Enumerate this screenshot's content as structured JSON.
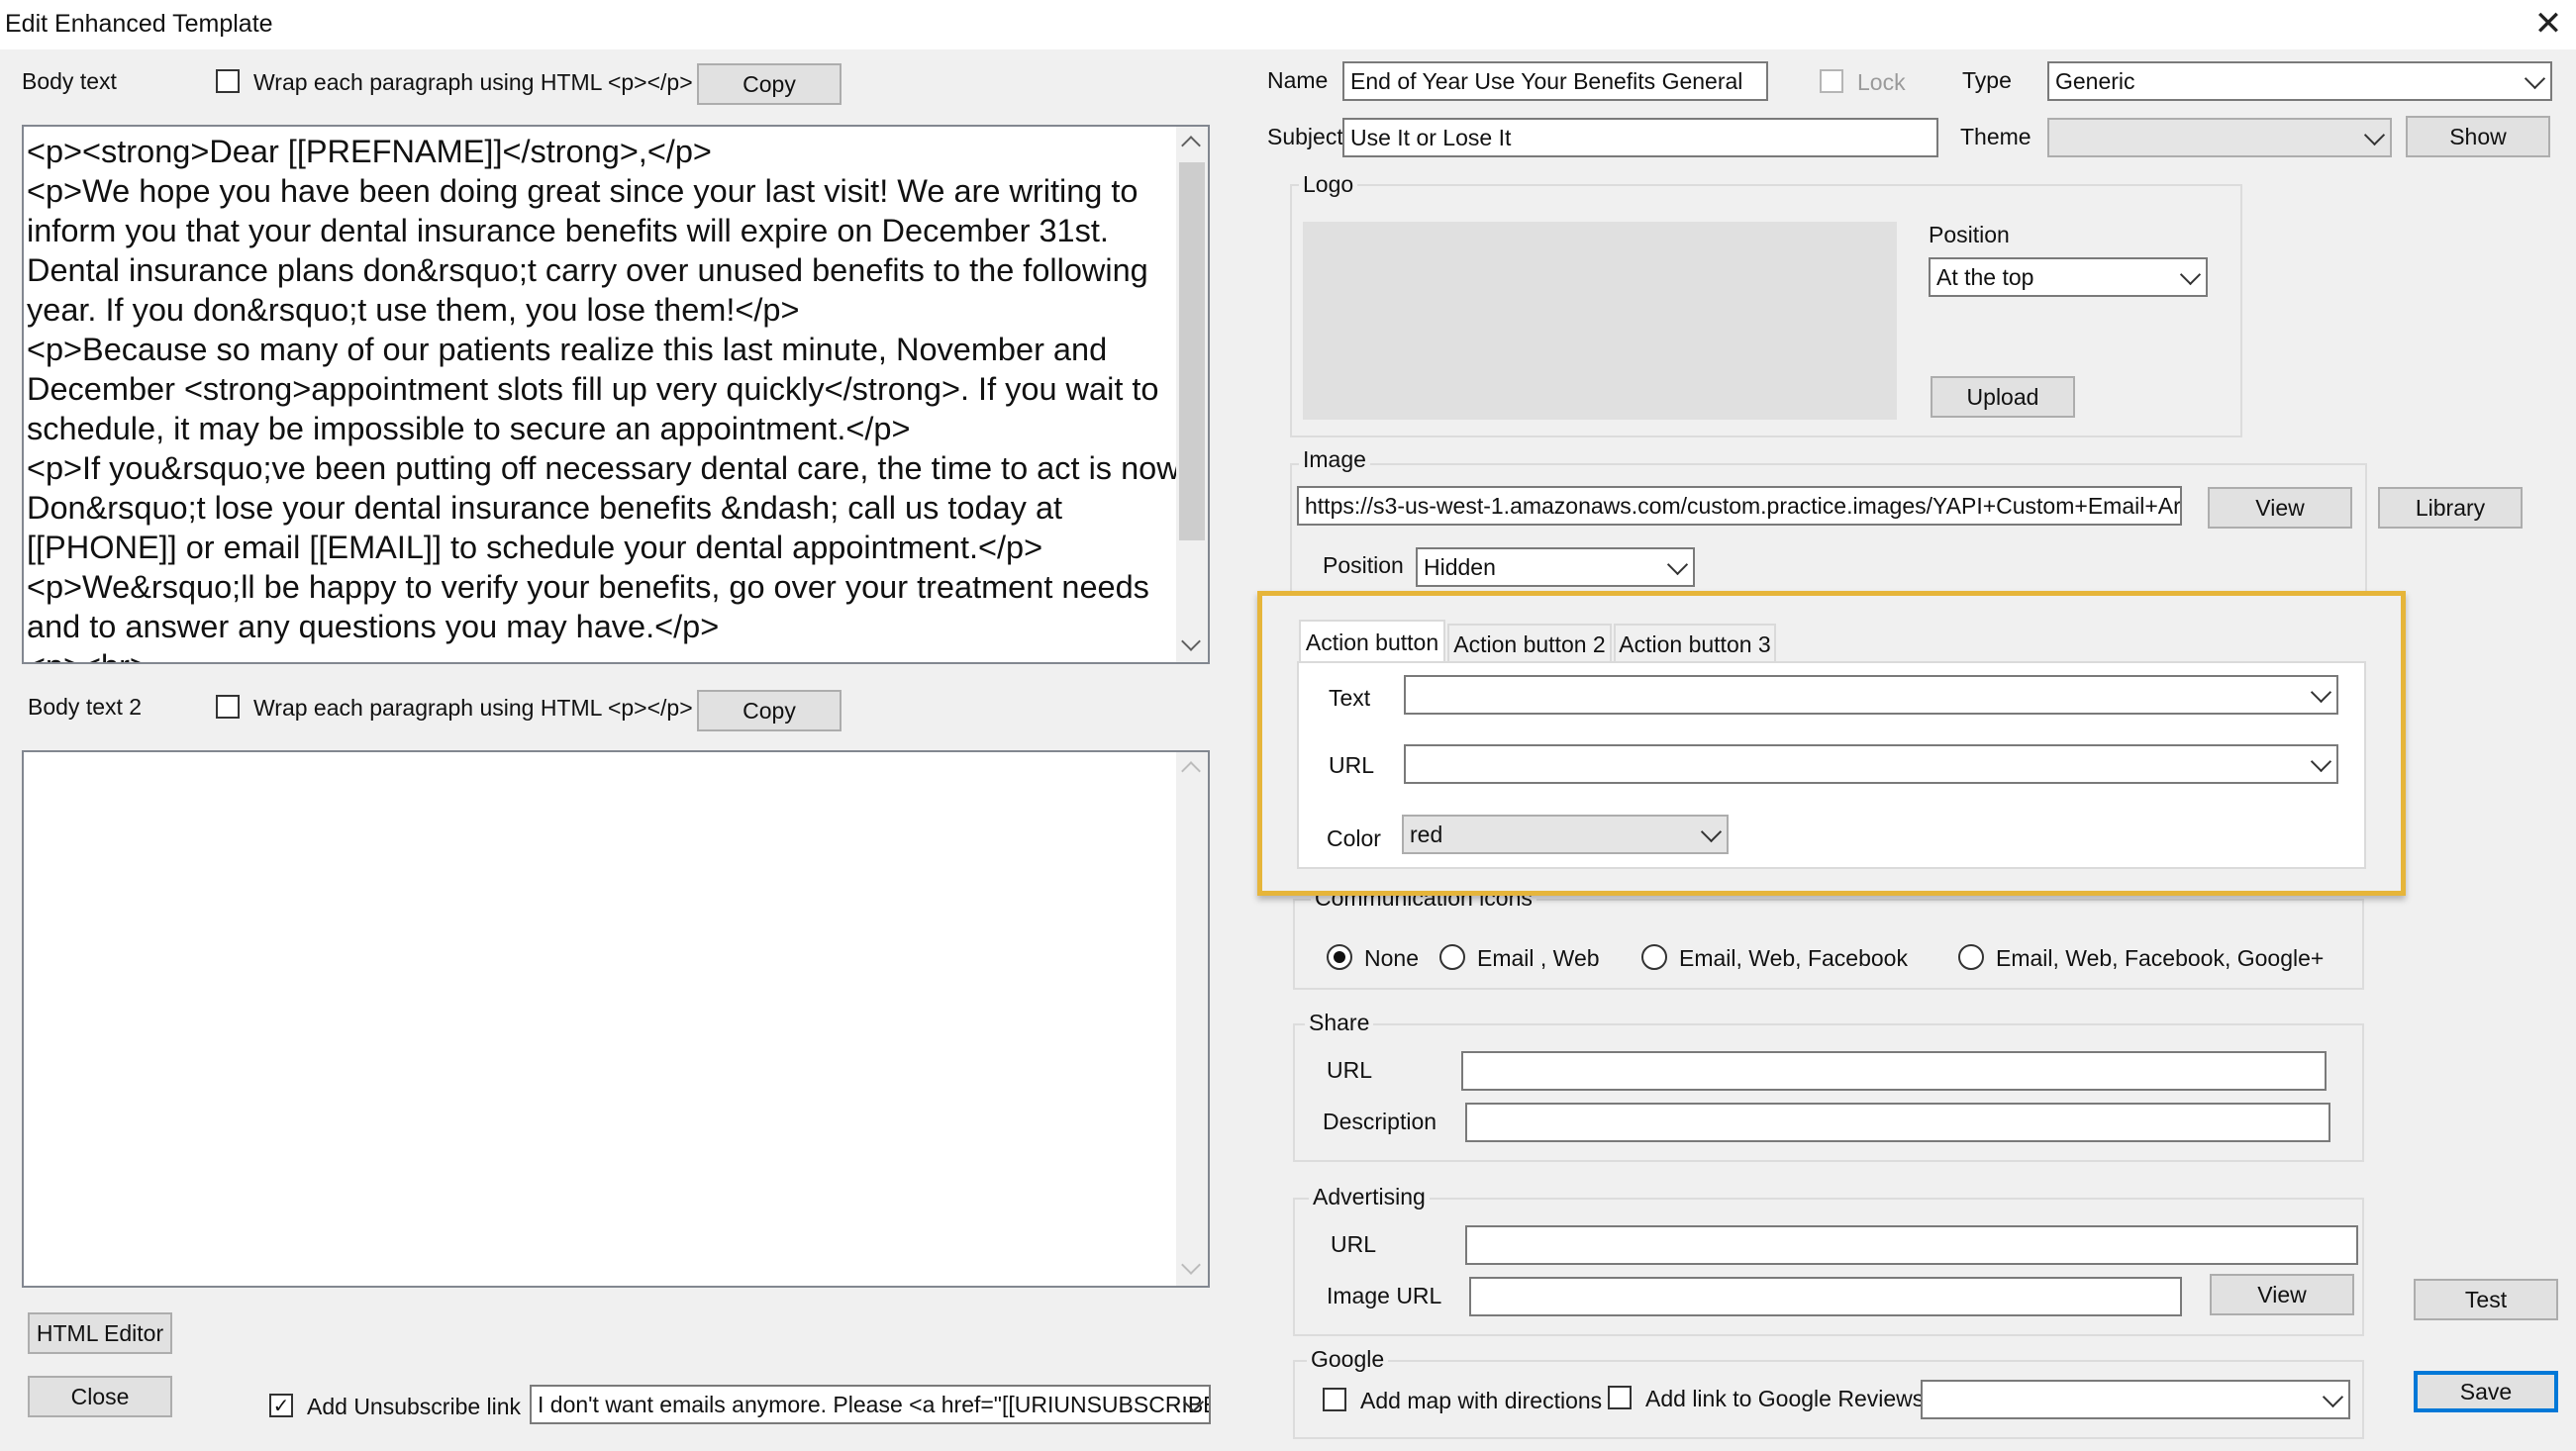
{
  "window": {
    "title": "Edit Enhanced Template",
    "close_glyph": "✕"
  },
  "body_text": {
    "label": "Body text",
    "wrap_label": "Wrap each paragraph using HTML <p></p>",
    "wrap_checked": false,
    "copy_label": "Copy",
    "content": "<p><strong>Dear [[PREFNAME]]</strong>,</p>\n<p>We hope you have been doing great since your last visit! We are writing to inform you that your dental insurance benefits will expire on December 31st. Dental insurance plans don&rsquo;t carry over unused benefits to the following year. If you don&rsquo;t use them, you lose them!</p>\n<p>Because so many of our patients realize this last minute, November and December <strong>appointment slots fill up very quickly</strong>. If you wait to schedule, it may be impossible to secure an appointment.</p>\n<p>If you&rsquo;ve been putting off necessary dental care, the time to act is now. Don&rsquo;t lose your dental insurance benefits &ndash; call us today at [[PHONE]] or email [[EMAIL]] to schedule your dental appointment.</p>\n<p>We&rsquo;ll be happy to verify your benefits, go over your treatment needs and to answer any questions you may have.</p>\n<p><br>"
  },
  "body_text_2": {
    "label": "Body text 2",
    "wrap_label": "Wrap each paragraph using HTML <p></p>",
    "wrap_checked": false,
    "copy_label": "Copy",
    "content": ""
  },
  "bottom_left": {
    "html_editor_label": "HTML Editor",
    "close_label": "Close",
    "unsubscribe_label": "Add Unsubscribe link",
    "unsubscribe_checked": true,
    "unsubscribe_value": "I don't want emails anymore. Please <a href=\"[[URIUNSUBSCRIBE]"
  },
  "details": {
    "name_label": "Name",
    "name_value": "End of Year Use Your Benefits General",
    "lock_label": "Lock",
    "lock_checked": false,
    "type_label": "Type",
    "type_value": "Generic",
    "subject_label": "Subject",
    "subject_value": "Use It or Lose It",
    "theme_label": "Theme",
    "theme_value": "",
    "show_label": "Show"
  },
  "logo": {
    "group_label": "Logo",
    "position_label": "Position",
    "position_value": "At the top",
    "upload_label": "Upload"
  },
  "image": {
    "group_label": "Image",
    "url_value": "https://s3-us-west-1.amazonaws.com/custom.practice.images/YAPI+Custom+Email+Art/End-",
    "view_label": "View",
    "library_label": "Library",
    "position_label": "Position",
    "position_value": "Hidden"
  },
  "action_buttons": {
    "tabs": [
      "Action button",
      "Action button 2",
      "Action button 3"
    ],
    "active_tab": 0,
    "text_label": "Text",
    "text_value": "",
    "url_label": "URL",
    "url_value": "",
    "color_label": "Color",
    "color_value": "red",
    "highlight_color": "#e6b53a"
  },
  "communication_icons": {
    "group_label": "Communication icons",
    "options": [
      "None",
      "Email , Web",
      "Email, Web, Facebook",
      "Email, Web, Facebook, Google+"
    ],
    "selected": 0
  },
  "share": {
    "group_label": "Share",
    "url_label": "URL",
    "url_value": "",
    "description_label": "Description",
    "description_value": ""
  },
  "advertising": {
    "group_label": "Advertising",
    "url_label": "URL",
    "url_value": "",
    "image_url_label": "Image URL",
    "image_url_value": "",
    "view_label": "View"
  },
  "google": {
    "group_label": "Google",
    "map_label": "Add map with directions",
    "map_checked": false,
    "reviews_label": "Add link to Google Reviews",
    "reviews_checked": false,
    "reviews_value": ""
  },
  "actions": {
    "test_label": "Test",
    "save_label": "Save"
  }
}
